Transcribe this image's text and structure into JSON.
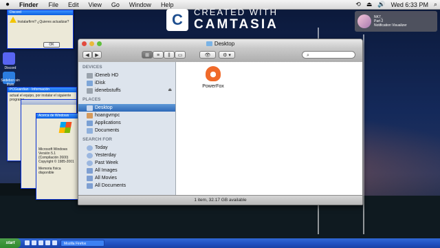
{
  "menubar": {
    "apple": "",
    "app_name": "Finder",
    "items": [
      "File",
      "Edit",
      "View",
      "Go",
      "Window",
      "Help"
    ],
    "clock": "Wed 6:33 PM"
  },
  "watermark": {
    "line1": "CREATED WITH",
    "line2": "CAMTASIA",
    "logo_letter": "C"
  },
  "notification": {
    "title": "NK7_",
    "line2": "Part 2",
    "line3": "Notification Visualizer"
  },
  "finder": {
    "title": "Desktop",
    "toolbar": {
      "back": "◀",
      "forward": "▶",
      "view_icon": "⊞",
      "view_list": "≡",
      "view_columns": "⫼",
      "view_cover": "▭",
      "quicklook": "👁",
      "action": "⚙ ▾"
    },
    "sidebar": {
      "devices_header": "DEVICES",
      "devices": [
        "iDeneb HD",
        "iDisk",
        "idenebstuffs"
      ],
      "places_header": "PLACES",
      "places": [
        "Desktop",
        "hoangvmpc",
        "Applications",
        "Documents"
      ],
      "search_header": "SEARCH FOR",
      "search": [
        "Today",
        "Yesterday",
        "Past Week",
        "All Images",
        "All Movies",
        "All Documents"
      ],
      "selected": "Desktop"
    },
    "files": [
      {
        "name": "PowerFox",
        "icon": "powerfox-icon"
      }
    ],
    "status": "1 item, 32.17 GB available"
  },
  "xp_dialogs": {
    "d1_title": "Discord",
    "d1_text": "Instalarfirm? ¿Quieres actualizar?",
    "d1_ok": "OK",
    "d2_title": "PCGuardian - Información",
    "d2_text": "actual el equipo, por instalar el siguiente programa",
    "d3_title": "Acerca de Windows",
    "d3_text": "Microsoft Windows Versión 5.1 (Compilación 2600) Copyright © 1985-2001",
    "d3_footer": "Memoria física disponible"
  },
  "desktop_icons": [
    "Discord",
    "Sedebcn sin título"
  ],
  "taskbar": {
    "start": "start",
    "active_item": "Mozilla Firefox"
  }
}
